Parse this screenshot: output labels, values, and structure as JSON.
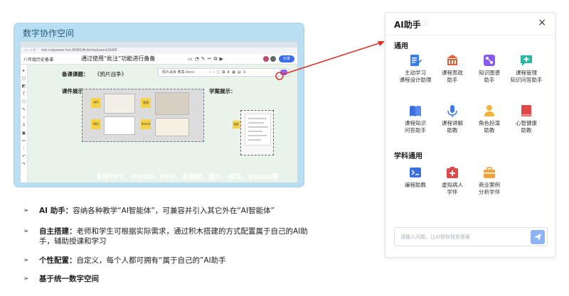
{
  "left_card": {
    "title": "数字协作空间",
    "browser": {
      "address": "kdt.coipower.fun:8080/#/whiteboard/2b68",
      "doc_name": "八年级历史备课",
      "toolbar_hint": "通过使用“批注”功能进行备备",
      "share_label": "分享"
    },
    "canvas": {
      "lesson_label": "备课课题：",
      "lesson_title": "《鸦片战争》",
      "showcase_label": "课件展示：",
      "plan_label": "学案展示：",
      "float_doc_name": "鸦片战争 教案.docx",
      "sticky_1": "PPT",
      "sticky_2": "视频",
      "sticky_3": "网页",
      "sticky_4": "Xmind",
      "sticky_5": "PDF",
      "support_text": "支持PPT、WORD、PDF、音视频、图片、网页、Xmind等"
    }
  },
  "bullets": [
    {
      "bold": "AI 助手：",
      "text": "容纳各种教学“AI智能体”，可兼容并引入其它外在“AI智能体”"
    },
    {
      "bold": "自主搭建：",
      "text": "老师和学生可根据实际需求，通过积木搭建的方式配置属于自己的AI助手，辅助授课和学习"
    },
    {
      "bold": "个性配置：",
      "text": "自定义，每个人都可拥有“属于自己的”AI助手"
    },
    {
      "bold": "基于统一数字空间",
      "text": ""
    }
  ],
  "bullet_marker": "➢",
  "panel": {
    "title": "AI助手",
    "close_icon": "×",
    "section_general": "通用",
    "section_subject": "学科通用",
    "general_items": [
      {
        "label": "主动学习\n课程设计助理",
        "icon": "doc-edit-icon",
        "color": "#3b7cf0"
      },
      {
        "label": "课程思政\n助手",
        "icon": "building-icon",
        "color": "#e0623a"
      },
      {
        "label": "知识图谱\n助手",
        "icon": "graph-icon",
        "color": "#8a5af0"
      },
      {
        "label": "课程管理\n知识问答助手",
        "icon": "chat-plus-icon",
        "color": "#2bb7a3"
      },
      {
        "label": "课程知识\n问答助手",
        "icon": "book-icon",
        "color": "#3b6fe0"
      },
      {
        "label": "课程讲解\n助教",
        "icon": "mic-icon",
        "color": "#3b7cf0"
      },
      {
        "label": "角色扮演\n助教",
        "icon": "person-icon",
        "color": "#f0b43a"
      },
      {
        "label": "心智健康\n助教",
        "icon": "heart-book-icon",
        "color": "#e04848"
      }
    ],
    "subject_items": [
      {
        "label": "编程助教",
        "icon": "terminal-icon",
        "color": "#3b6fe0"
      },
      {
        "label": "虚拟病人\n学伴",
        "icon": "medical-icon",
        "color": "#e04848"
      },
      {
        "label": "商业案例\n分析学伴",
        "icon": "briefcase-icon",
        "color": "#f0a33a"
      }
    ],
    "input_placeholder": "请输入问题，让AI帮你找到答案",
    "send_icon": "send-icon"
  }
}
